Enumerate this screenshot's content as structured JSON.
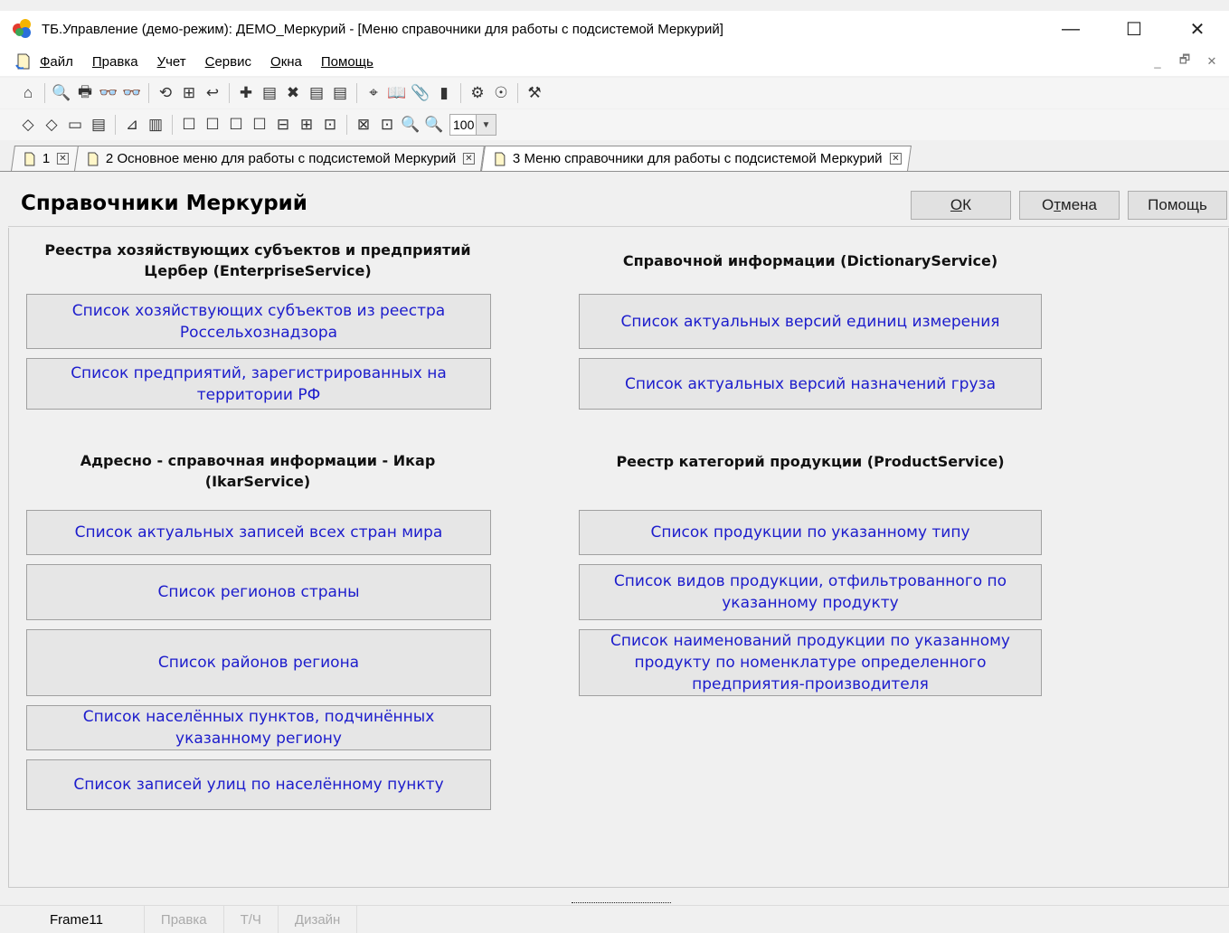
{
  "window": {
    "title": "ТБ.Управление (демо-режим): ДЕМО_Меркурий - [Меню справочники для работы с подсистемой Меркурий]",
    "minimize_glyph": "—",
    "maximize_glyph": "☐",
    "close_glyph": "✕"
  },
  "menu": {
    "items": [
      {
        "u": "Ф",
        "rest": "айл"
      },
      {
        "u": "П",
        "rest": "равка"
      },
      {
        "u": "У",
        "rest": "чет"
      },
      {
        "u": "С",
        "rest": "ервис"
      },
      {
        "u": "О",
        "rest": "кна"
      },
      {
        "u": "",
        "rest": "Помощь"
      }
    ],
    "mdi_min": "_",
    "mdi_restore": "🗗",
    "mdi_close": "✕"
  },
  "toolbar": {
    "zoom_value": "100",
    "row1_icons": [
      "⌂",
      "|",
      "🔍",
      "🖶",
      "👓",
      "👓",
      "|",
      "⟲",
      "⊞",
      "↩",
      "|",
      "✚",
      "▤",
      "✖",
      "▤",
      "▤",
      "|",
      "⌖",
      "📖",
      "📎",
      "▮",
      "|",
      "⚙",
      "☉",
      "|",
      "⚒"
    ],
    "row2_icons": [
      "◇",
      "◇",
      "▭",
      "▤",
      "|",
      "⊿",
      "▥",
      "|",
      "☐",
      "☐",
      "☐",
      "☐",
      "⊟",
      "⊞",
      "⊡",
      "|",
      "⊠",
      "⊡",
      "🔍",
      "🔍"
    ]
  },
  "tabs": [
    {
      "label": "1",
      "active": false
    },
    {
      "label": "2 Основное меню для работы с подсистемой Меркурий",
      "active": false
    },
    {
      "label": "3 Меню справочники для работы с подсистемой Меркурий",
      "active": true
    }
  ],
  "tab_close_glyph": "✕",
  "page": {
    "title": "Справочники Меркурий",
    "ok": {
      "u": "О",
      "rest": "К"
    },
    "cancel": {
      "pre": "О",
      "u": "т",
      "rest": "мена"
    },
    "help": "Помощь"
  },
  "groups": {
    "enterprise": {
      "title_line1": "Реестра хозяйствующих субъектов и предприятий",
      "title_line2": "Цербер (EnterpriseService)",
      "buttons": [
        "Список хозяйствующих субъектов из реестра Россельхознадзора",
        "Список предприятий, зарегистрированных на территории РФ"
      ]
    },
    "dictionary": {
      "title": "Справочной информации (DictionaryService)",
      "buttons": [
        "Список актуальных версий единиц измерения",
        "Список актуальных версий назначений груза"
      ]
    },
    "ikar": {
      "title_line1": "Адресно - справочная информации - Икар",
      "title_line2": "(IkarService)",
      "buttons": [
        "Список актуальных записей всех стран мира",
        "Список регионов страны",
        "Список районов региона",
        "Список населённых пунктов, подчинённых указанному региону",
        "Список записей улиц по населённому пункту"
      ]
    },
    "product": {
      "title": "Реестр категорий продукции (ProductService)",
      "buttons": [
        "Список продукции по указанному типу",
        "Список видов продукции, отфильтрованного по указанному продукту",
        "Список наименований продукции по указанному продукту по номенклатуре определенного предприятия-производителя"
      ]
    }
  },
  "statusbar": {
    "items": [
      "Frame11",
      "Правка",
      "Т/Ч",
      "Дизайн"
    ]
  }
}
